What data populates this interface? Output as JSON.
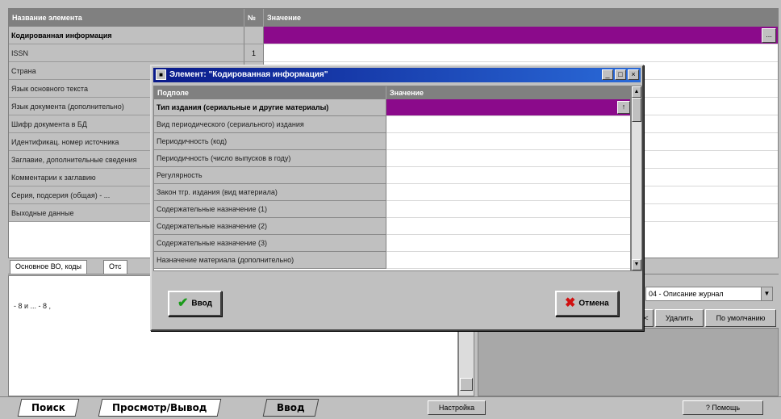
{
  "main_grid": {
    "headers": {
      "name": "Название элемента",
      "no": "№",
      "value": "Значение"
    },
    "rows": [
      {
        "name": "Кодированная информация",
        "no": "",
        "bold": true,
        "selected": true
      },
      {
        "name": "ISSN",
        "no": "1",
        "bold": false,
        "selected": false
      },
      {
        "name": "Страна",
        "no": "",
        "bold": false,
        "selected": false
      },
      {
        "name": "Язык основного текста",
        "no": "",
        "bold": false,
        "selected": false
      },
      {
        "name": "Язык документа (дополнительно)",
        "no": "",
        "bold": false,
        "selected": false
      },
      {
        "name": "Шифр документа в БД",
        "no": "",
        "bold": false,
        "selected": false
      },
      {
        "name": "Идентификац. номер источника",
        "no": "",
        "bold": false,
        "selected": false
      },
      {
        "name": "Заглавие, дополнительные сведения",
        "no": "",
        "bold": false,
        "selected": false
      },
      {
        "name": "Комментарии к заглавию",
        "no": "",
        "bold": false,
        "selected": false
      },
      {
        "name": "Серия, подсерия (общая) - ...",
        "no": "",
        "bold": false,
        "selected": false
      },
      {
        "name": "Выходные данные",
        "no": "",
        "bold": false,
        "selected": false
      }
    ],
    "ellipsis": "..."
  },
  "tabs_strip": {
    "tab1": "Основное ВО, коды",
    "tab2": "Отс"
  },
  "lower": {
    "formula": "- 8 и ... - 8 ,",
    "combo_value": "04 - Описание журнал",
    "combo_arrow": "▼",
    "btn_delete": "Удалить",
    "btn_default": "По умолчанию",
    "btn_left": "<"
  },
  "bottom": {
    "tab_search": "Поиск",
    "tab_view": "Просмотр/Вывод",
    "tab_input": "Ввод",
    "btn_settings": "Настройка",
    "btn_help": "? Помощь"
  },
  "dialog": {
    "title": "Элемент: \"Кодированная информация\"",
    "app_icon": "■",
    "btn_min": "_",
    "btn_max": "□",
    "btn_close": "×",
    "headers": {
      "sub": "Подполе",
      "value": "Значение"
    },
    "rows": [
      {
        "label": "Тип издания (сериальные и другие материалы)",
        "bold": true,
        "selected": true
      },
      {
        "label": "Вид периодического (сериального) издания",
        "bold": false,
        "selected": false
      },
      {
        "label": "Периодичность (код)",
        "bold": false,
        "selected": false
      },
      {
        "label": "Периодичность (число выпусков в году)",
        "bold": false,
        "selected": false
      },
      {
        "label": "Регулярность",
        "bold": false,
        "selected": false
      },
      {
        "label": "Закон тгр. издания (вид материала)",
        "bold": false,
        "selected": false
      },
      {
        "label": "Содержательные назначение (1)",
        "bold": false,
        "selected": false
      },
      {
        "label": "Содержательные назначение (2)",
        "bold": false,
        "selected": false
      },
      {
        "label": "Содержательные назначение (3)",
        "bold": false,
        "selected": false
      },
      {
        "label": "Назначение материала (дополнительно)",
        "bold": false,
        "selected": false
      }
    ],
    "up_btn": "↑",
    "scroll_up": "▲",
    "scroll_down": "▼",
    "ok_label": "Ввод",
    "cancel_label": "Отмена"
  }
}
